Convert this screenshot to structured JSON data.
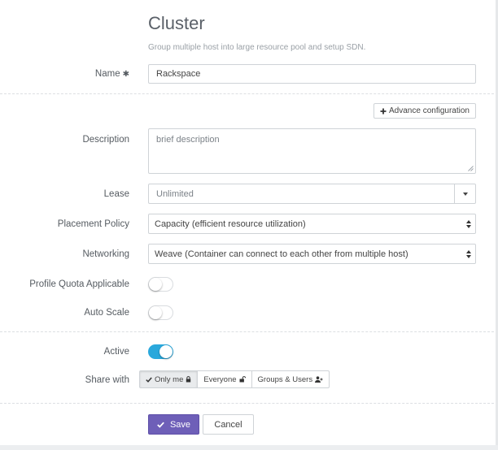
{
  "header": {
    "title": "Cluster",
    "subtitle": "Group multiple host into large resource pool and setup SDN."
  },
  "form": {
    "name": {
      "label": "Name",
      "required_mark": "✱",
      "value": "Rackspace"
    },
    "advance_label": "Advance configuration",
    "description": {
      "label": "Description",
      "placeholder": "brief description"
    },
    "lease": {
      "label": "Lease",
      "value": "Unlimited"
    },
    "placement": {
      "label": "Placement Policy",
      "value": "Capacity (efficient resource utilization)"
    },
    "networking": {
      "label": "Networking",
      "value": "Weave (Container can connect to each other from multiple host)"
    },
    "quota": {
      "label": "Profile Quota Applicable",
      "on": false
    },
    "autoscale": {
      "label": "Auto Scale",
      "on": false
    },
    "active": {
      "label": "Active",
      "on": true
    },
    "share": {
      "label": "Share with",
      "options": [
        "Only me",
        "Everyone",
        "Groups & Users"
      ],
      "selected": "Only me"
    }
  },
  "actions": {
    "save_label": "Save",
    "cancel_label": "Cancel"
  },
  "colors": {
    "accent_purple": "#6e5fb8",
    "toggle_on": "#2aa8dc"
  }
}
